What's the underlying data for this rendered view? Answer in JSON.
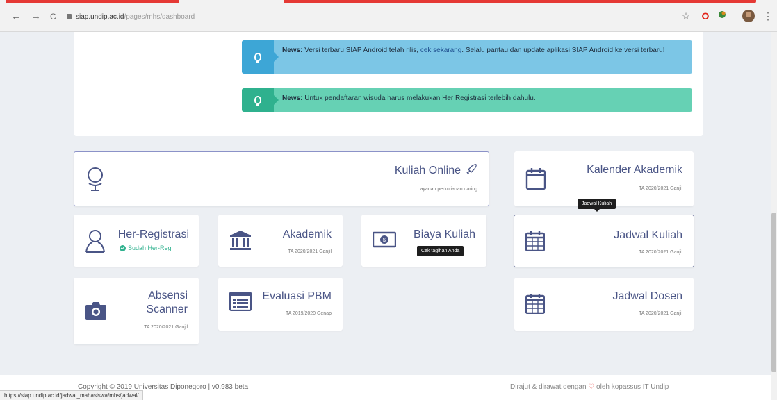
{
  "browser": {
    "back_icon": "←",
    "forward_icon": "→",
    "reload_icon": "C",
    "url_host": "siap.undip.ac.id",
    "url_path": "/pages/mhs/dashboard",
    "star_icon": "☆",
    "opera_icon": "O",
    "menu_icon": "⋮",
    "status_url": "https://siap.undip.ac.id/jadwal_mahasiswa/mhs/jadwal/"
  },
  "alerts": {
    "android": {
      "label": "News:",
      "text_before": "Versi terbaru SIAP Android telah rilis,",
      "link": "cek sekarang",
      "text_after": ". Selalu pantau dan update aplikasi SIAP Android ke versi terbaru!"
    },
    "wisuda": {
      "label": "News:",
      "text": "Untuk pendaftaran wisuda harus melakukan Her Registrasi terlebih dahulu."
    }
  },
  "cards": {
    "kuliah_online": {
      "title": "Kuliah Online",
      "subtitle": "Layanan perkuliahan daring"
    },
    "kalender": {
      "title": "Kalender Akademik",
      "subtitle": "TA 2020/2021 Ganjil"
    },
    "her_registrasi": {
      "title": "Her-Registrasi",
      "status": "Sudah Her-Reg"
    },
    "akademik": {
      "title": "Akademik",
      "subtitle": "TA 2020/2021 Ganjil"
    },
    "biaya": {
      "title": "Biaya Kuliah",
      "tooltip": "Cek tagihan Anda"
    },
    "jadwal_kuliah": {
      "title": "Jadwal Kuliah",
      "subtitle": "TA 2020/2021 Ganjil",
      "tooltip": "Jadwal Kuliah"
    },
    "absensi": {
      "title_line1": "Absensi",
      "title_line2": "Scanner",
      "subtitle": "TA 2020/2021 Ganjil"
    },
    "evaluasi": {
      "title": "Evaluasi PBM",
      "subtitle": "TA 2019/2020 Genap"
    },
    "jadwal_dosen": {
      "title": "Jadwal Dosen",
      "subtitle": "TA 2020/2021 Ganjil"
    }
  },
  "footer": {
    "copyright": "Copyright © 2019 Universitas Diponegoro | v0.983 beta",
    "made_prefix": "Dirajut & dirawat dengan",
    "heart": "♡",
    "made_suffix": "oleh kopassus IT Undip"
  },
  "colors": {
    "accent": "#4a5586",
    "info_alert": "#7cc6e6",
    "success_alert": "#66d1b4",
    "status_ok": "#2fb18e"
  },
  "icons": [
    "globe-icon",
    "rocket-icon",
    "calendar-icon",
    "user-icon",
    "bank-icon",
    "money-icon",
    "camera-icon",
    "list-icon",
    "lightbulb-icon"
  ]
}
